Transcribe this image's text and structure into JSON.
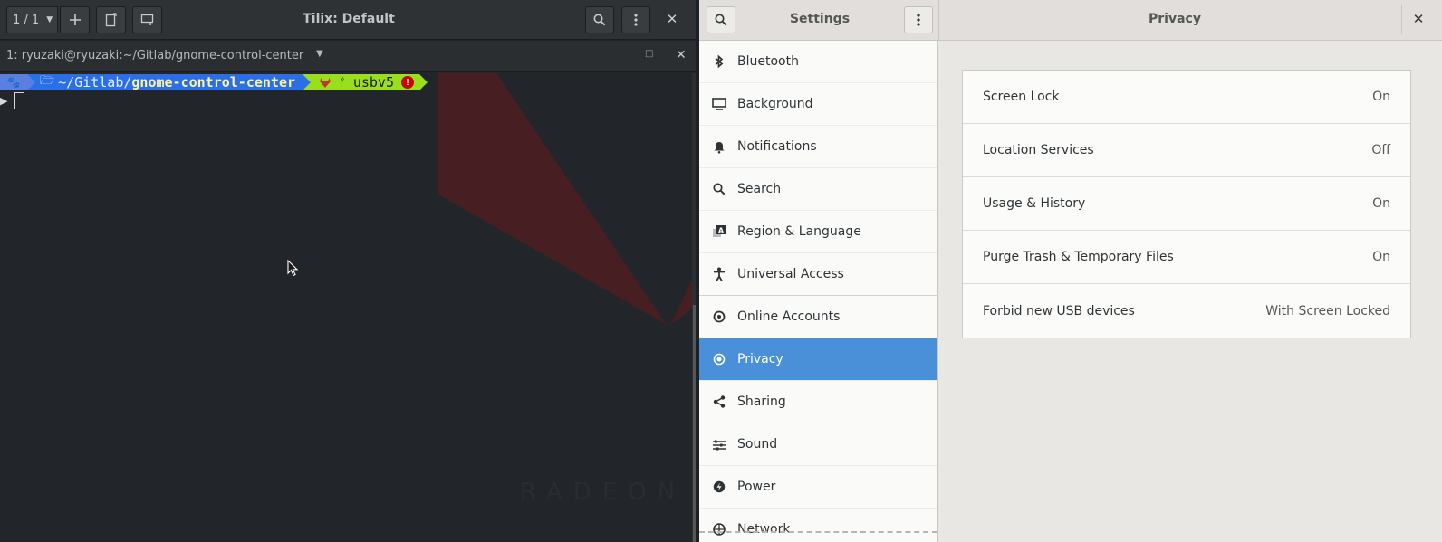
{
  "tilix": {
    "title": "Tilix: Default",
    "session_label": "1 / 1",
    "terminal_title": "1: ryuzaki@ryuzaki:~/Gitlab/gnome-control-center",
    "prompt": {
      "path_prefix": "~/Gitlab/",
      "path_dir": "gnome-control-center",
      "git_branch": "usbv5"
    },
    "watermark": "RADEON"
  },
  "settings": {
    "title": "Settings",
    "panel_title": "Privacy",
    "sidebar": [
      {
        "label": "Bluetooth",
        "icon": "bluetooth-icon"
      },
      {
        "label": "Background",
        "icon": "monitor-icon"
      },
      {
        "label": "Notifications",
        "icon": "bell-icon"
      },
      {
        "label": "Search",
        "icon": "search-icon"
      },
      {
        "label": "Region & Language",
        "icon": "language-icon"
      },
      {
        "label": "Universal Access",
        "icon": "accessibility-icon"
      },
      {
        "label": "Online Accounts",
        "icon": "at-sign-icon"
      },
      {
        "label": "Privacy",
        "icon": "privacy-icon",
        "active": true
      },
      {
        "label": "Sharing",
        "icon": "share-icon"
      },
      {
        "label": "Sound",
        "icon": "equalizer-icon"
      },
      {
        "label": "Power",
        "icon": "power-icon"
      },
      {
        "label": "Network",
        "icon": "network-icon"
      }
    ],
    "privacy_rows": [
      {
        "label": "Screen Lock",
        "value": "On"
      },
      {
        "label": "Location Services",
        "value": "Off"
      },
      {
        "label": "Usage & History",
        "value": "On"
      },
      {
        "label": "Purge Trash & Temporary Files",
        "value": "On"
      },
      {
        "label": "Forbid new USB devices",
        "value": "With Screen Locked"
      }
    ]
  },
  "colors": {
    "accent": "#4a90d9",
    "terminal_bg": "#22262a",
    "prompt_path_bg": "#2a6fe6",
    "prompt_git_bg": "#9adf1c"
  }
}
